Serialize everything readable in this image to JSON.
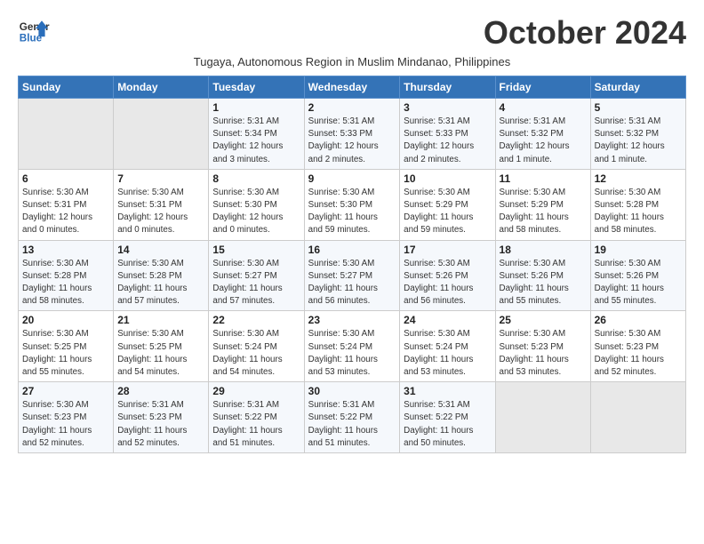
{
  "logo": {
    "line1": "General",
    "line2": "Blue"
  },
  "title": "October 2024",
  "subtitle": "Tugaya, Autonomous Region in Muslim Mindanao, Philippines",
  "headers": [
    "Sunday",
    "Monday",
    "Tuesday",
    "Wednesday",
    "Thursday",
    "Friday",
    "Saturday"
  ],
  "weeks": [
    [
      {
        "num": "",
        "info": ""
      },
      {
        "num": "",
        "info": ""
      },
      {
        "num": "1",
        "info": "Sunrise: 5:31 AM\nSunset: 5:34 PM\nDaylight: 12 hours\nand 3 minutes."
      },
      {
        "num": "2",
        "info": "Sunrise: 5:31 AM\nSunset: 5:33 PM\nDaylight: 12 hours\nand 2 minutes."
      },
      {
        "num": "3",
        "info": "Sunrise: 5:31 AM\nSunset: 5:33 PM\nDaylight: 12 hours\nand 2 minutes."
      },
      {
        "num": "4",
        "info": "Sunrise: 5:31 AM\nSunset: 5:32 PM\nDaylight: 12 hours\nand 1 minute."
      },
      {
        "num": "5",
        "info": "Sunrise: 5:31 AM\nSunset: 5:32 PM\nDaylight: 12 hours\nand 1 minute."
      }
    ],
    [
      {
        "num": "6",
        "info": "Sunrise: 5:30 AM\nSunset: 5:31 PM\nDaylight: 12 hours\nand 0 minutes."
      },
      {
        "num": "7",
        "info": "Sunrise: 5:30 AM\nSunset: 5:31 PM\nDaylight: 12 hours\nand 0 minutes."
      },
      {
        "num": "8",
        "info": "Sunrise: 5:30 AM\nSunset: 5:30 PM\nDaylight: 12 hours\nand 0 minutes."
      },
      {
        "num": "9",
        "info": "Sunrise: 5:30 AM\nSunset: 5:30 PM\nDaylight: 11 hours\nand 59 minutes."
      },
      {
        "num": "10",
        "info": "Sunrise: 5:30 AM\nSunset: 5:29 PM\nDaylight: 11 hours\nand 59 minutes."
      },
      {
        "num": "11",
        "info": "Sunrise: 5:30 AM\nSunset: 5:29 PM\nDaylight: 11 hours\nand 58 minutes."
      },
      {
        "num": "12",
        "info": "Sunrise: 5:30 AM\nSunset: 5:28 PM\nDaylight: 11 hours\nand 58 minutes."
      }
    ],
    [
      {
        "num": "13",
        "info": "Sunrise: 5:30 AM\nSunset: 5:28 PM\nDaylight: 11 hours\nand 58 minutes."
      },
      {
        "num": "14",
        "info": "Sunrise: 5:30 AM\nSunset: 5:28 PM\nDaylight: 11 hours\nand 57 minutes."
      },
      {
        "num": "15",
        "info": "Sunrise: 5:30 AM\nSunset: 5:27 PM\nDaylight: 11 hours\nand 57 minutes."
      },
      {
        "num": "16",
        "info": "Sunrise: 5:30 AM\nSunset: 5:27 PM\nDaylight: 11 hours\nand 56 minutes."
      },
      {
        "num": "17",
        "info": "Sunrise: 5:30 AM\nSunset: 5:26 PM\nDaylight: 11 hours\nand 56 minutes."
      },
      {
        "num": "18",
        "info": "Sunrise: 5:30 AM\nSunset: 5:26 PM\nDaylight: 11 hours\nand 55 minutes."
      },
      {
        "num": "19",
        "info": "Sunrise: 5:30 AM\nSunset: 5:26 PM\nDaylight: 11 hours\nand 55 minutes."
      }
    ],
    [
      {
        "num": "20",
        "info": "Sunrise: 5:30 AM\nSunset: 5:25 PM\nDaylight: 11 hours\nand 55 minutes."
      },
      {
        "num": "21",
        "info": "Sunrise: 5:30 AM\nSunset: 5:25 PM\nDaylight: 11 hours\nand 54 minutes."
      },
      {
        "num": "22",
        "info": "Sunrise: 5:30 AM\nSunset: 5:24 PM\nDaylight: 11 hours\nand 54 minutes."
      },
      {
        "num": "23",
        "info": "Sunrise: 5:30 AM\nSunset: 5:24 PM\nDaylight: 11 hours\nand 53 minutes."
      },
      {
        "num": "24",
        "info": "Sunrise: 5:30 AM\nSunset: 5:24 PM\nDaylight: 11 hours\nand 53 minutes."
      },
      {
        "num": "25",
        "info": "Sunrise: 5:30 AM\nSunset: 5:23 PM\nDaylight: 11 hours\nand 53 minutes."
      },
      {
        "num": "26",
        "info": "Sunrise: 5:30 AM\nSunset: 5:23 PM\nDaylight: 11 hours\nand 52 minutes."
      }
    ],
    [
      {
        "num": "27",
        "info": "Sunrise: 5:30 AM\nSunset: 5:23 PM\nDaylight: 11 hours\nand 52 minutes."
      },
      {
        "num": "28",
        "info": "Sunrise: 5:31 AM\nSunset: 5:23 PM\nDaylight: 11 hours\nand 52 minutes."
      },
      {
        "num": "29",
        "info": "Sunrise: 5:31 AM\nSunset: 5:22 PM\nDaylight: 11 hours\nand 51 minutes."
      },
      {
        "num": "30",
        "info": "Sunrise: 5:31 AM\nSunset: 5:22 PM\nDaylight: 11 hours\nand 51 minutes."
      },
      {
        "num": "31",
        "info": "Sunrise: 5:31 AM\nSunset: 5:22 PM\nDaylight: 11 hours\nand 50 minutes."
      },
      {
        "num": "",
        "info": ""
      },
      {
        "num": "",
        "info": ""
      }
    ]
  ]
}
